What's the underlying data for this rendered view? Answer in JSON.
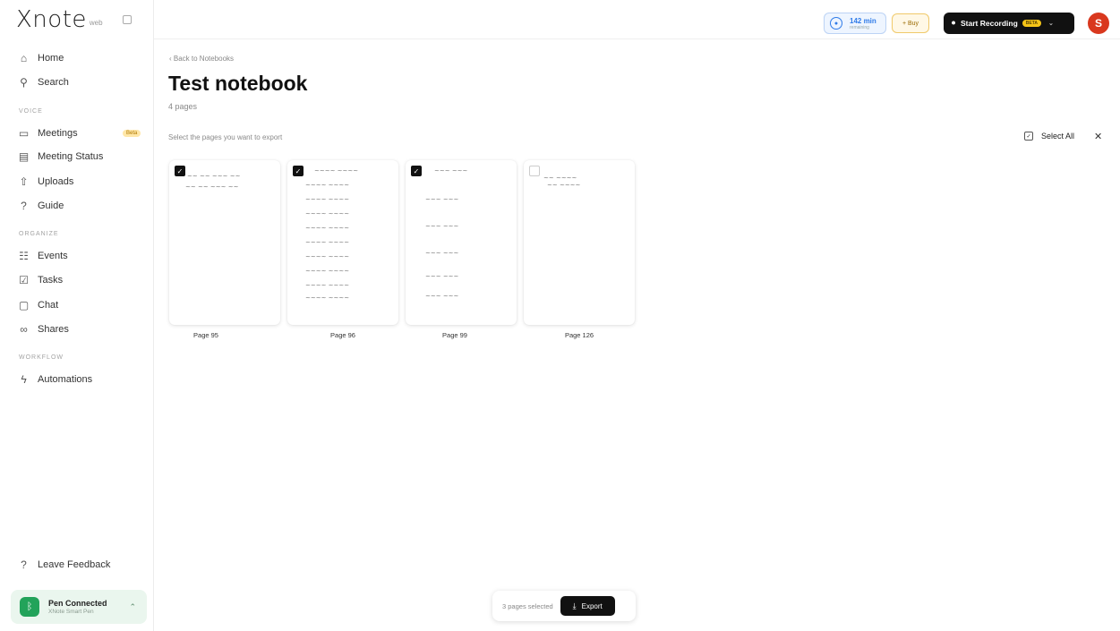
{
  "app": {
    "logo": "Xnote",
    "logo_sub": "web"
  },
  "sidebar": {
    "items": [
      {
        "label": "Home",
        "icon": "home-icon"
      },
      {
        "label": "Search",
        "icon": "search-icon"
      },
      {
        "label": "Meetings",
        "icon": "calendar-icon",
        "badge": "Beta"
      },
      {
        "label": "Meeting Status",
        "icon": "clipboard-icon"
      },
      {
        "label": "Uploads",
        "icon": "upload-icon"
      },
      {
        "label": "Guide",
        "icon": "help-icon"
      },
      {
        "label": "Events",
        "icon": "events-icon"
      },
      {
        "label": "Tasks",
        "icon": "tasks-icon"
      },
      {
        "label": "Chat",
        "icon": "chat-icon"
      },
      {
        "label": "Shares",
        "icon": "link-icon"
      },
      {
        "label": "Automations",
        "icon": "automation-icon"
      }
    ],
    "sections": {
      "voice": "VOICE",
      "organize": "ORGANIZE",
      "workflow": "WORKFLOW"
    },
    "feedback": "Leave Feedback",
    "pen": {
      "title": "Pen Connected",
      "subtitle": "XNote Smart Pen"
    }
  },
  "topbar": {
    "minutes_value": "142 min",
    "minutes_sub": "remaining",
    "buy_label": "+ Buy",
    "record_label": "Start Recording",
    "record_badge": "BETA",
    "avatar_initial": "S"
  },
  "main": {
    "back_label": "Back to Notebooks",
    "title": "Test notebook",
    "page_count": "4 pages",
    "instruction": "Select the pages you want to export",
    "select_all": "Select All"
  },
  "pages": [
    {
      "label": "Page 95",
      "selected": true
    },
    {
      "label": "Page 96",
      "selected": true
    },
    {
      "label": "Page 99",
      "selected": true
    },
    {
      "label": "Page 126",
      "selected": false
    }
  ],
  "export_bar": {
    "count": "3 pages selected",
    "button": "Export"
  }
}
